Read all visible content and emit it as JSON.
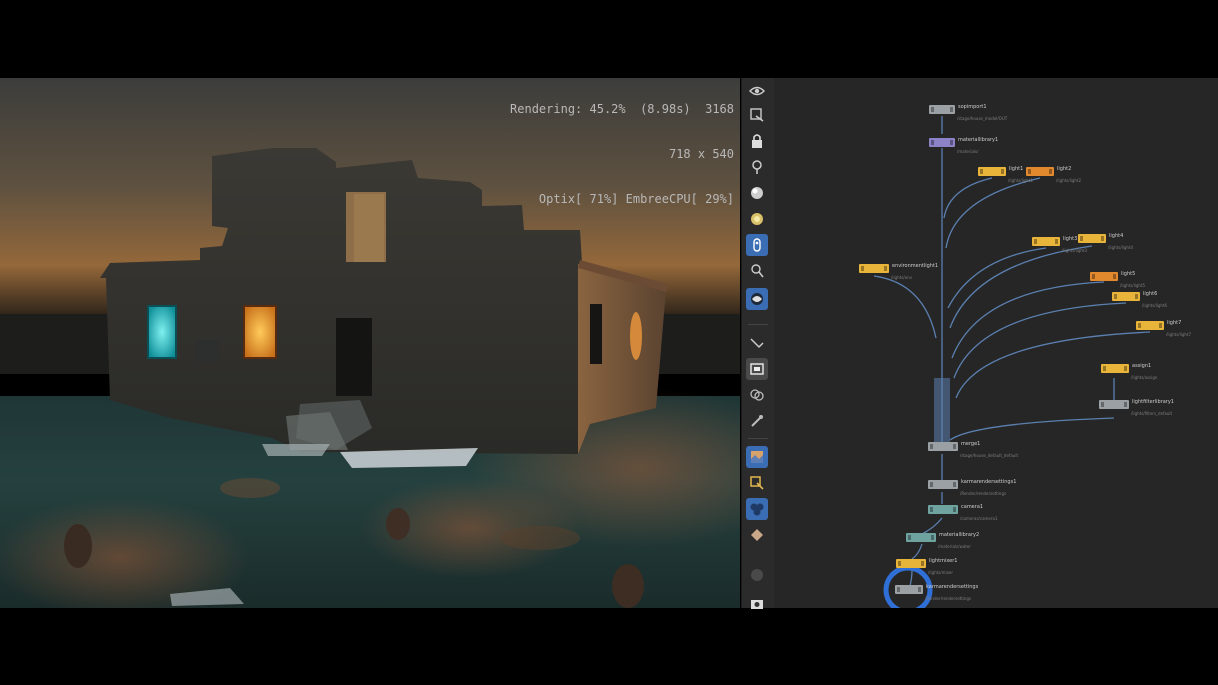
{
  "viewport": {
    "overlay_lines": [
      "Rendering: 45.2%  (8.98s)  3168",
      "718 x 540",
      "Optix[ 71%] EmbreeCPU[ 29%]"
    ]
  },
  "toolbar": {
    "tools": [
      {
        "name": "view-options-icon",
        "active": false
      },
      {
        "name": "display-options-icon",
        "active": false
      },
      {
        "name": "lock-camera-icon",
        "active": false
      },
      {
        "name": "pin-icon",
        "active": false
      },
      {
        "name": "sphere-shading-icon",
        "active": false
      },
      {
        "name": "light-bulb-icon",
        "active": false
      },
      {
        "name": "headlight-icon",
        "active": true
      },
      {
        "name": "camera-lights-icon",
        "active": false
      },
      {
        "name": "render-globe-icon",
        "active": true
      },
      {
        "name": "snapping-icon",
        "active": false
      },
      {
        "name": "background-image-icon",
        "active": false
      },
      {
        "name": "selection-mode-icon",
        "active": false
      },
      {
        "name": "brush-icon",
        "active": false
      },
      {
        "name": "texture-icon",
        "active": true
      },
      {
        "name": "transform-handle-icon",
        "active": false
      },
      {
        "name": "materials-icon",
        "active": true
      },
      {
        "name": "diamond-icon",
        "active": false
      },
      {
        "name": "gray-circle-icon",
        "active": false
      },
      {
        "name": "camera-icon",
        "active": false
      }
    ]
  },
  "network": {
    "colors": {
      "gray": "#9aa0a4",
      "yellow": "#e8b43a",
      "orange": "#e2882d",
      "purple": "#8c82c8",
      "teal": "#6fa3a0",
      "wire": "#5b80b0",
      "selected_ring": "#2f6fd6"
    },
    "nodes": [
      {
        "id": "sopimport1",
        "color": "gray",
        "label": "sopimport1",
        "sub": "/stage/house_model/OUT"
      },
      {
        "id": "materiallibrary1",
        "color": "purple",
        "label": "materiallibrary1",
        "sub": "/materials/"
      },
      {
        "id": "light1",
        "color": "yellow",
        "label": "light1",
        "sub": "/lights/light1"
      },
      {
        "id": "light2",
        "color": "orange",
        "label": "light2",
        "sub": "/lights/light2"
      },
      {
        "id": "light3",
        "color": "yellow",
        "label": "light3",
        "sub": "/lights/light3"
      },
      {
        "id": "light4",
        "color": "yellow",
        "label": "light4",
        "sub": "/lights/light4"
      },
      {
        "id": "domelight",
        "color": "yellow",
        "label": "environmentlight1",
        "sub": "/lights/env"
      },
      {
        "id": "light5",
        "color": "orange",
        "label": "light5",
        "sub": "/lights/light5"
      },
      {
        "id": "light6",
        "color": "yellow",
        "label": "light6",
        "sub": "/lights/light6"
      },
      {
        "id": "light7",
        "color": "yellow",
        "label": "light7",
        "sub": "/lights/light7"
      },
      {
        "id": "assign1",
        "color": "yellow",
        "label": "assign1",
        "sub": "/lights/assign"
      },
      {
        "id": "lightfilterlibrary1",
        "color": "gray",
        "label": "lightfilterlibrary1",
        "sub": "/lights/filters_default"
      },
      {
        "id": "merge1",
        "color": "gray",
        "label": "merge1",
        "sub": "/stage/house_default_default"
      },
      {
        "id": "karmarendersettings1",
        "color": "gray",
        "label": "karmarendersettings1",
        "sub": "/Render/rendersettings"
      },
      {
        "id": "camera1",
        "color": "teal",
        "label": "camera1",
        "sub": "/cameras/camera1"
      },
      {
        "id": "materiallibrary2",
        "color": "teal",
        "label": "materiallibrary2",
        "sub": "/materials/water"
      },
      {
        "id": "lightmixer1",
        "color": "yellow",
        "label": "lightmixer1",
        "sub": "/lights/mixer"
      },
      {
        "id": "karmarendersettings",
        "color": "gray",
        "label": "karmarendersettings",
        "sub": "/Render/rendersettings"
      }
    ]
  }
}
